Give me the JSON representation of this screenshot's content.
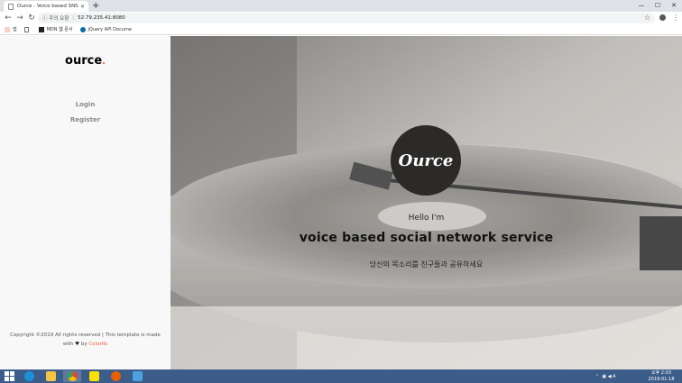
{
  "browser": {
    "tab_title": "Ource - Voice based SNS",
    "new_tab": "+",
    "security_label": "주의 요함",
    "url": "52.79.235.41:8080",
    "bookmarks": [
      {
        "label": "앱",
        "icon": "apps-icon"
      },
      {
        "label": "",
        "icon": "file-icon"
      },
      {
        "label": "MDN 웹 문서",
        "icon": "mdn-icon"
      },
      {
        "label": "jQuery API Docume",
        "icon": "jquery-icon"
      }
    ]
  },
  "sidebar": {
    "logo": "ource",
    "logo_dot": ".",
    "nav": [
      {
        "label": "Login"
      },
      {
        "label": "Register"
      }
    ],
    "copyright_line1": "Copyright ©2019 All rights reserved | This template is made",
    "copyright_with": "with",
    "copyright_by": "by",
    "copyright_brand": "Colorlib"
  },
  "hero": {
    "badge": "Ource",
    "hello": "Hello I'm",
    "tagline": "voice based social network service",
    "subtitle": "당신의 목소리를 친구들과 공유하세요"
  },
  "taskbar": {
    "clock_period": "오후 2:03",
    "clock_date": "2019-01-18",
    "apps": [
      "ie-icon",
      "file-explorer-icon",
      "chrome-icon",
      "kakaotalk-icon",
      "firefox-icon",
      "app-icon"
    ]
  },
  "colors": {
    "accent": "#f15c3e",
    "taskbar": "#3c5c8a",
    "badge": "#2b2a29"
  }
}
